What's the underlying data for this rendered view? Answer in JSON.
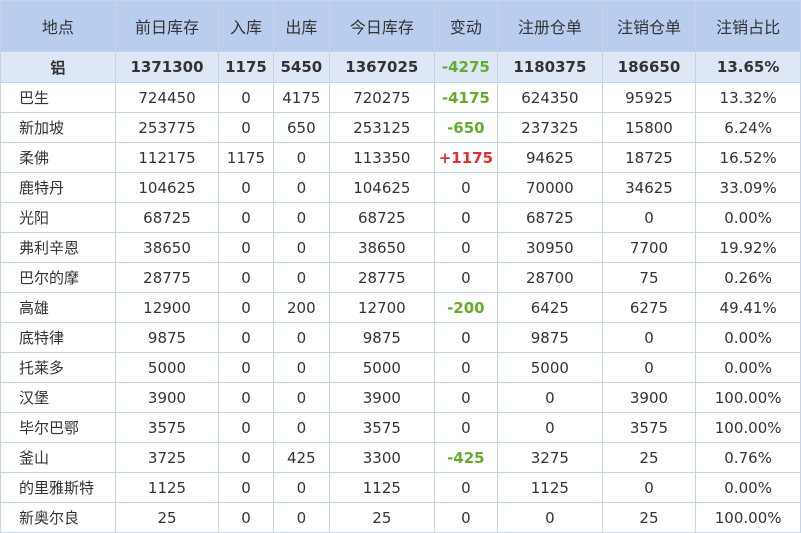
{
  "table": {
    "headers": [
      "地点",
      "前日库存",
      "入库",
      "出库",
      "今日库存",
      "变动",
      "注册仓单",
      "注销仓单",
      "注销占比"
    ],
    "total": [
      "铝",
      "1371300",
      "1175",
      "5450",
      "1367025",
      "-4275",
      "1180375",
      "186650",
      "13.65%"
    ],
    "rows": [
      [
        "巴生",
        "724450",
        "0",
        "4175",
        "720275",
        "-4175",
        "624350",
        "95925",
        "13.32%"
      ],
      [
        "新加坡",
        "253775",
        "0",
        "650",
        "253125",
        "-650",
        "237325",
        "15800",
        "6.24%"
      ],
      [
        "柔佛",
        "112175",
        "1175",
        "0",
        "113350",
        "+1175",
        "94625",
        "18725",
        "16.52%"
      ],
      [
        "鹿特丹",
        "104625",
        "0",
        "0",
        "104625",
        "0",
        "70000",
        "34625",
        "33.09%"
      ],
      [
        "光阳",
        "68725",
        "0",
        "0",
        "68725",
        "0",
        "68725",
        "0",
        "0.00%"
      ],
      [
        "弗利辛恩",
        "38650",
        "0",
        "0",
        "38650",
        "0",
        "30950",
        "7700",
        "19.92%"
      ],
      [
        "巴尔的摩",
        "28775",
        "0",
        "0",
        "28775",
        "0",
        "28700",
        "75",
        "0.26%"
      ],
      [
        "高雄",
        "12900",
        "0",
        "200",
        "12700",
        "-200",
        "6425",
        "6275",
        "49.41%"
      ],
      [
        "底特律",
        "9875",
        "0",
        "0",
        "9875",
        "0",
        "9875",
        "0",
        "0.00%"
      ],
      [
        "托莱多",
        "5000",
        "0",
        "0",
        "5000",
        "0",
        "5000",
        "0",
        "0.00%"
      ],
      [
        "汉堡",
        "3900",
        "0",
        "0",
        "3900",
        "0",
        "0",
        "3900",
        "100.00%"
      ],
      [
        "毕尔巴鄂",
        "3575",
        "0",
        "0",
        "3575",
        "0",
        "0",
        "3575",
        "100.00%"
      ],
      [
        "釜山",
        "3725",
        "0",
        "425",
        "3300",
        "-425",
        "3275",
        "25",
        "0.76%"
      ],
      [
        "的里雅斯特",
        "1125",
        "0",
        "0",
        "1125",
        "0",
        "1125",
        "0",
        "0.00%"
      ],
      [
        "新奥尔良",
        "25",
        "0",
        "0",
        "25",
        "0",
        "0",
        "25",
        "100.00%"
      ]
    ]
  },
  "colors": {
    "header_bg": "#b9cdef",
    "total_bg": "#dde7f6",
    "border": "#c4d3e8",
    "negative_change": "#66aa2e",
    "positive_change": "#e03030"
  }
}
